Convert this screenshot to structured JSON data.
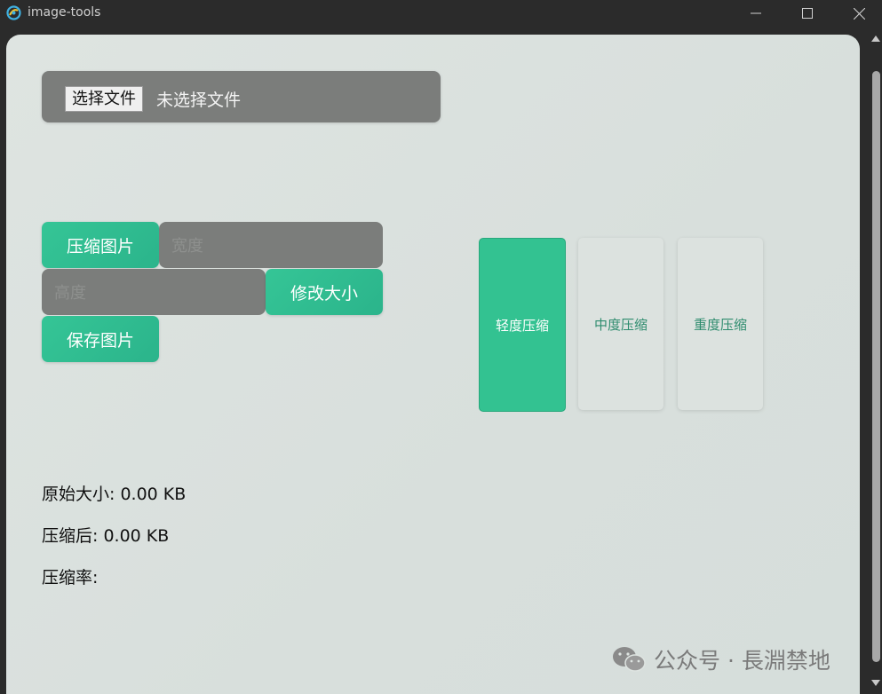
{
  "window": {
    "title": "image-tools"
  },
  "file": {
    "button_label": "选择文件",
    "status": "未选择文件"
  },
  "actions": {
    "compress_label": "压缩图片",
    "width_placeholder": "宽度",
    "height_placeholder": "高度",
    "resize_label": "修改大小",
    "save_label": "保存图片"
  },
  "levels": [
    {
      "label": "轻度压缩",
      "active": true
    },
    {
      "label": "中度压缩",
      "active": false
    },
    {
      "label": "重度压缩",
      "active": false
    }
  ],
  "stats": {
    "original": "原始大小: 0.00 KB",
    "compressed": "压缩后: 0.00 KB",
    "ratio": "压缩率:"
  },
  "watermark": {
    "text": "公众号 · 長淵禁地"
  },
  "colors": {
    "accent": "#33c291",
    "input_bg": "#7b7d7b",
    "content_bg": "#dee4e1",
    "titlebar_bg": "#2b2b2b"
  },
  "icons": [
    "app-icon",
    "minimize-icon",
    "maximize-icon",
    "close-icon",
    "scroll-up-icon",
    "scroll-down-icon",
    "wechat-icon"
  ]
}
